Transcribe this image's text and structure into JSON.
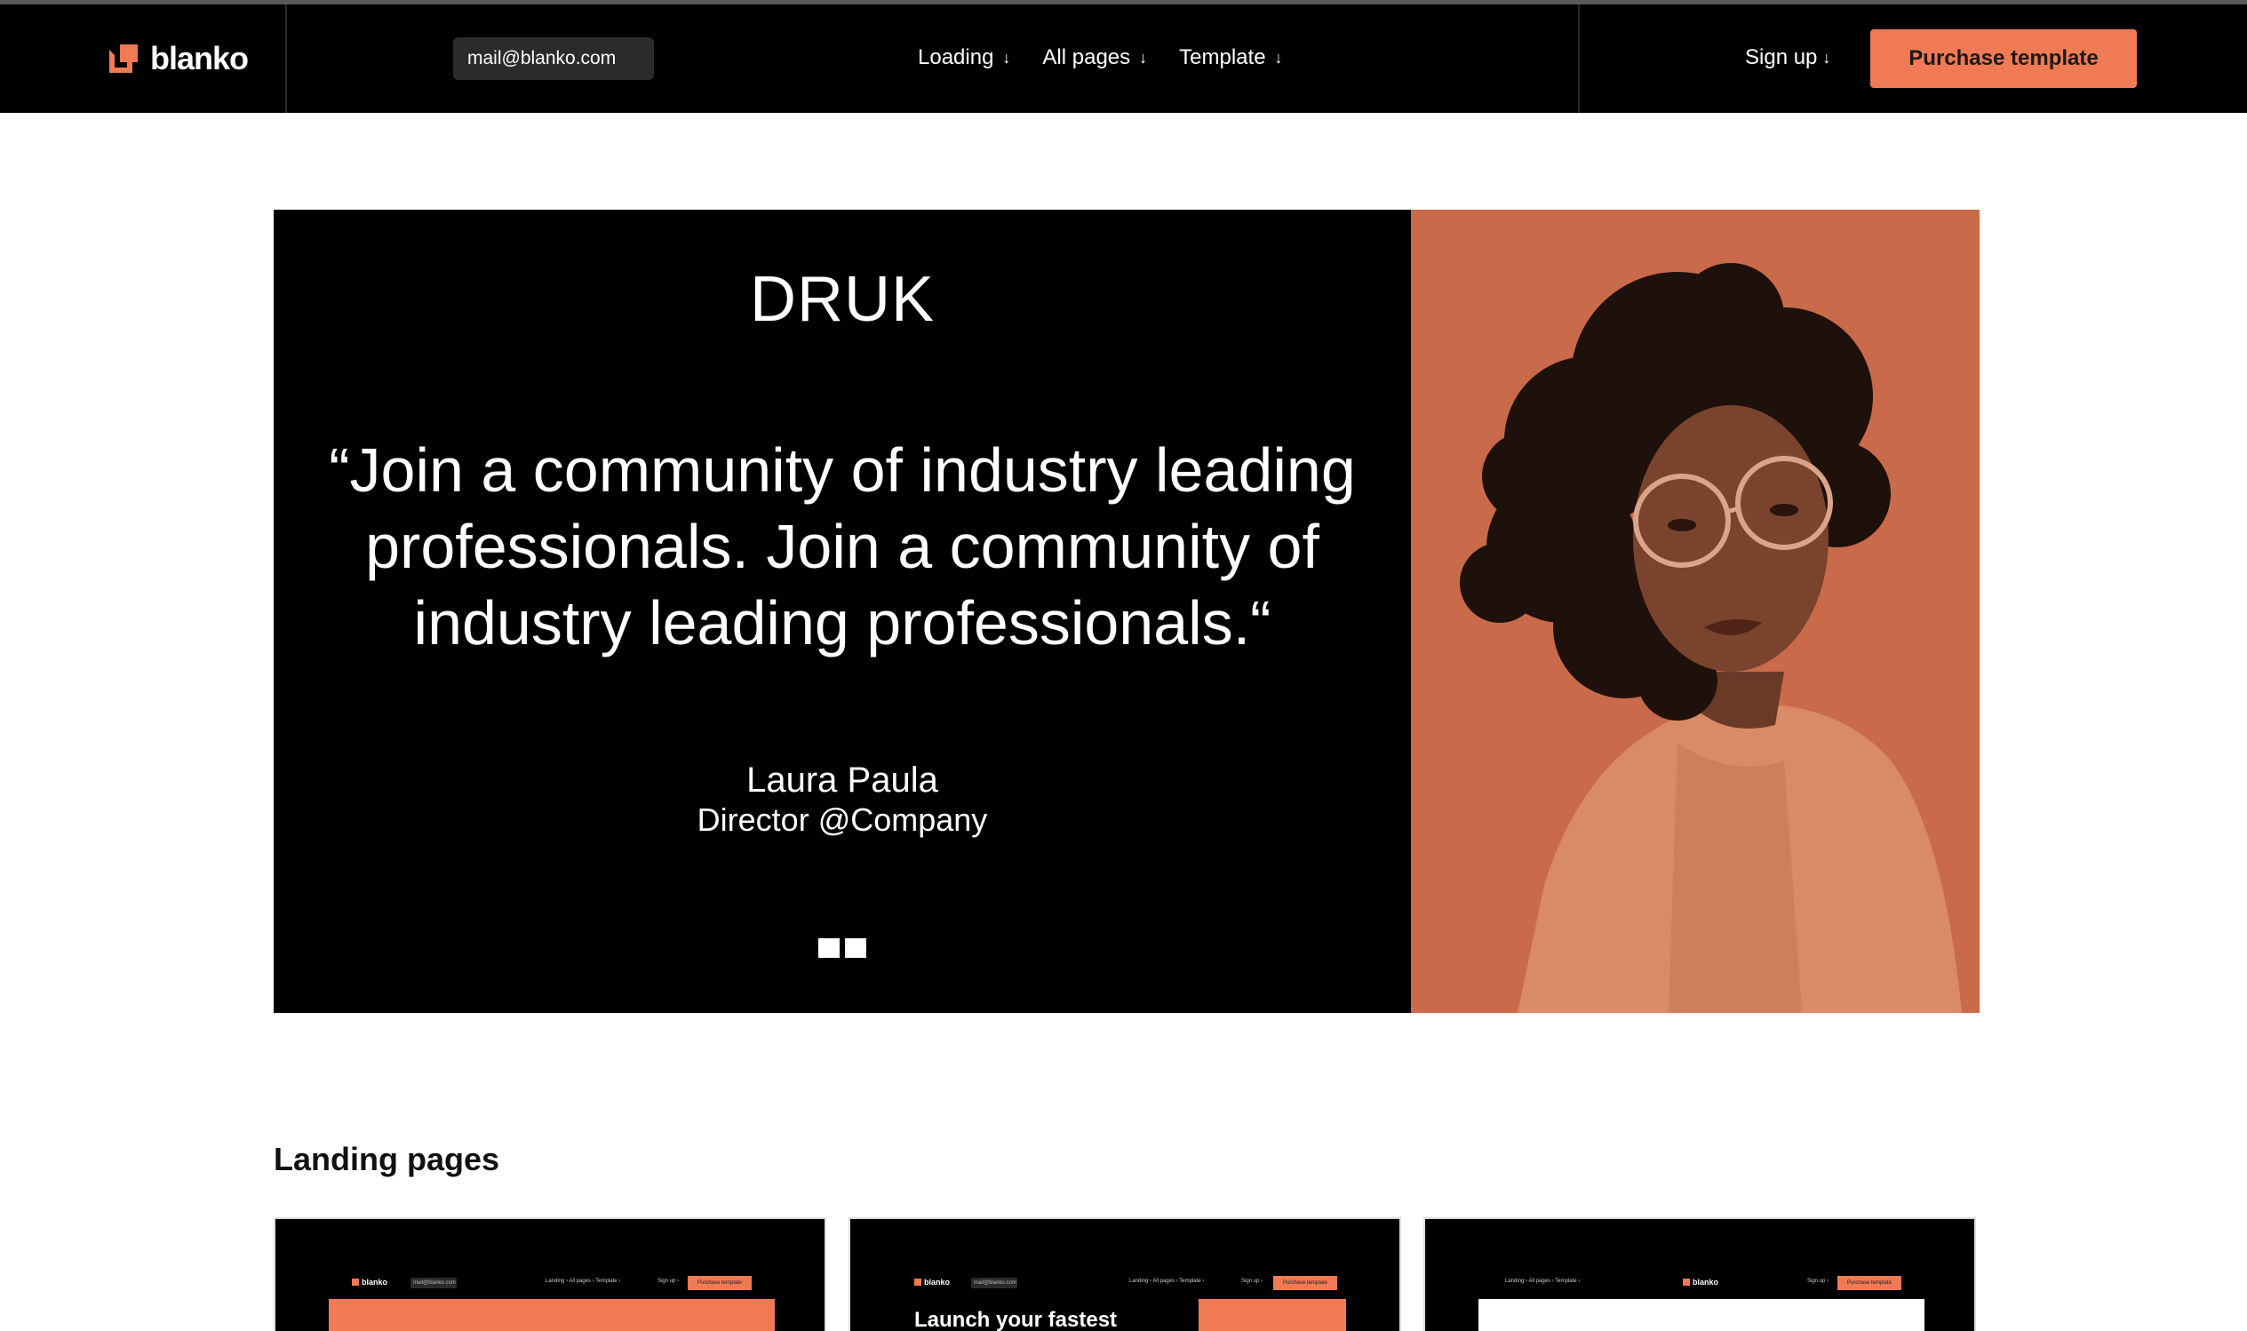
{
  "navbar": {
    "brand": "blanko",
    "email_value": "mail@blanko.com",
    "menu": [
      {
        "label": "Loading",
        "arrow": "↓"
      },
      {
        "label": "All pages",
        "arrow": "↓"
      },
      {
        "label": "Template",
        "arrow": "↓"
      }
    ],
    "signup_label": "Sign up",
    "signup_arrow": "↓",
    "purchase_label": "Purchase template"
  },
  "testimonial": {
    "brand_word": "DRUK",
    "quote": "“Join a community of industry leading professionals. Join a community of industry leading professionals.“",
    "name": "Laura Paula",
    "role": "Director @Company",
    "accent_color": "#c96a4a"
  },
  "landing": {
    "title": "Landing pages",
    "thumbnails": [
      {
        "brand": "blanko",
        "email": "mail@blanko.com",
        "menu": "Landing ›   All pages ›   Template ›",
        "signup": "Sign up ›",
        "button": "Purchase template"
      },
      {
        "brand": "blanko",
        "email": "mail@blanko.com",
        "menu": "Landing ›   All pages ›   Template ›",
        "signup": "Sign up ›",
        "button": "Purchase template",
        "headline": "Launch your fastest"
      },
      {
        "brand": "blanko",
        "menu": "Landing ›   All pages ›   Template ›",
        "signup": "Sign up ›",
        "button": "Purchase template"
      }
    ]
  },
  "colors": {
    "accent": "#ef7a54",
    "nav_bg": "#000000",
    "page_bg": "#ffffff"
  }
}
